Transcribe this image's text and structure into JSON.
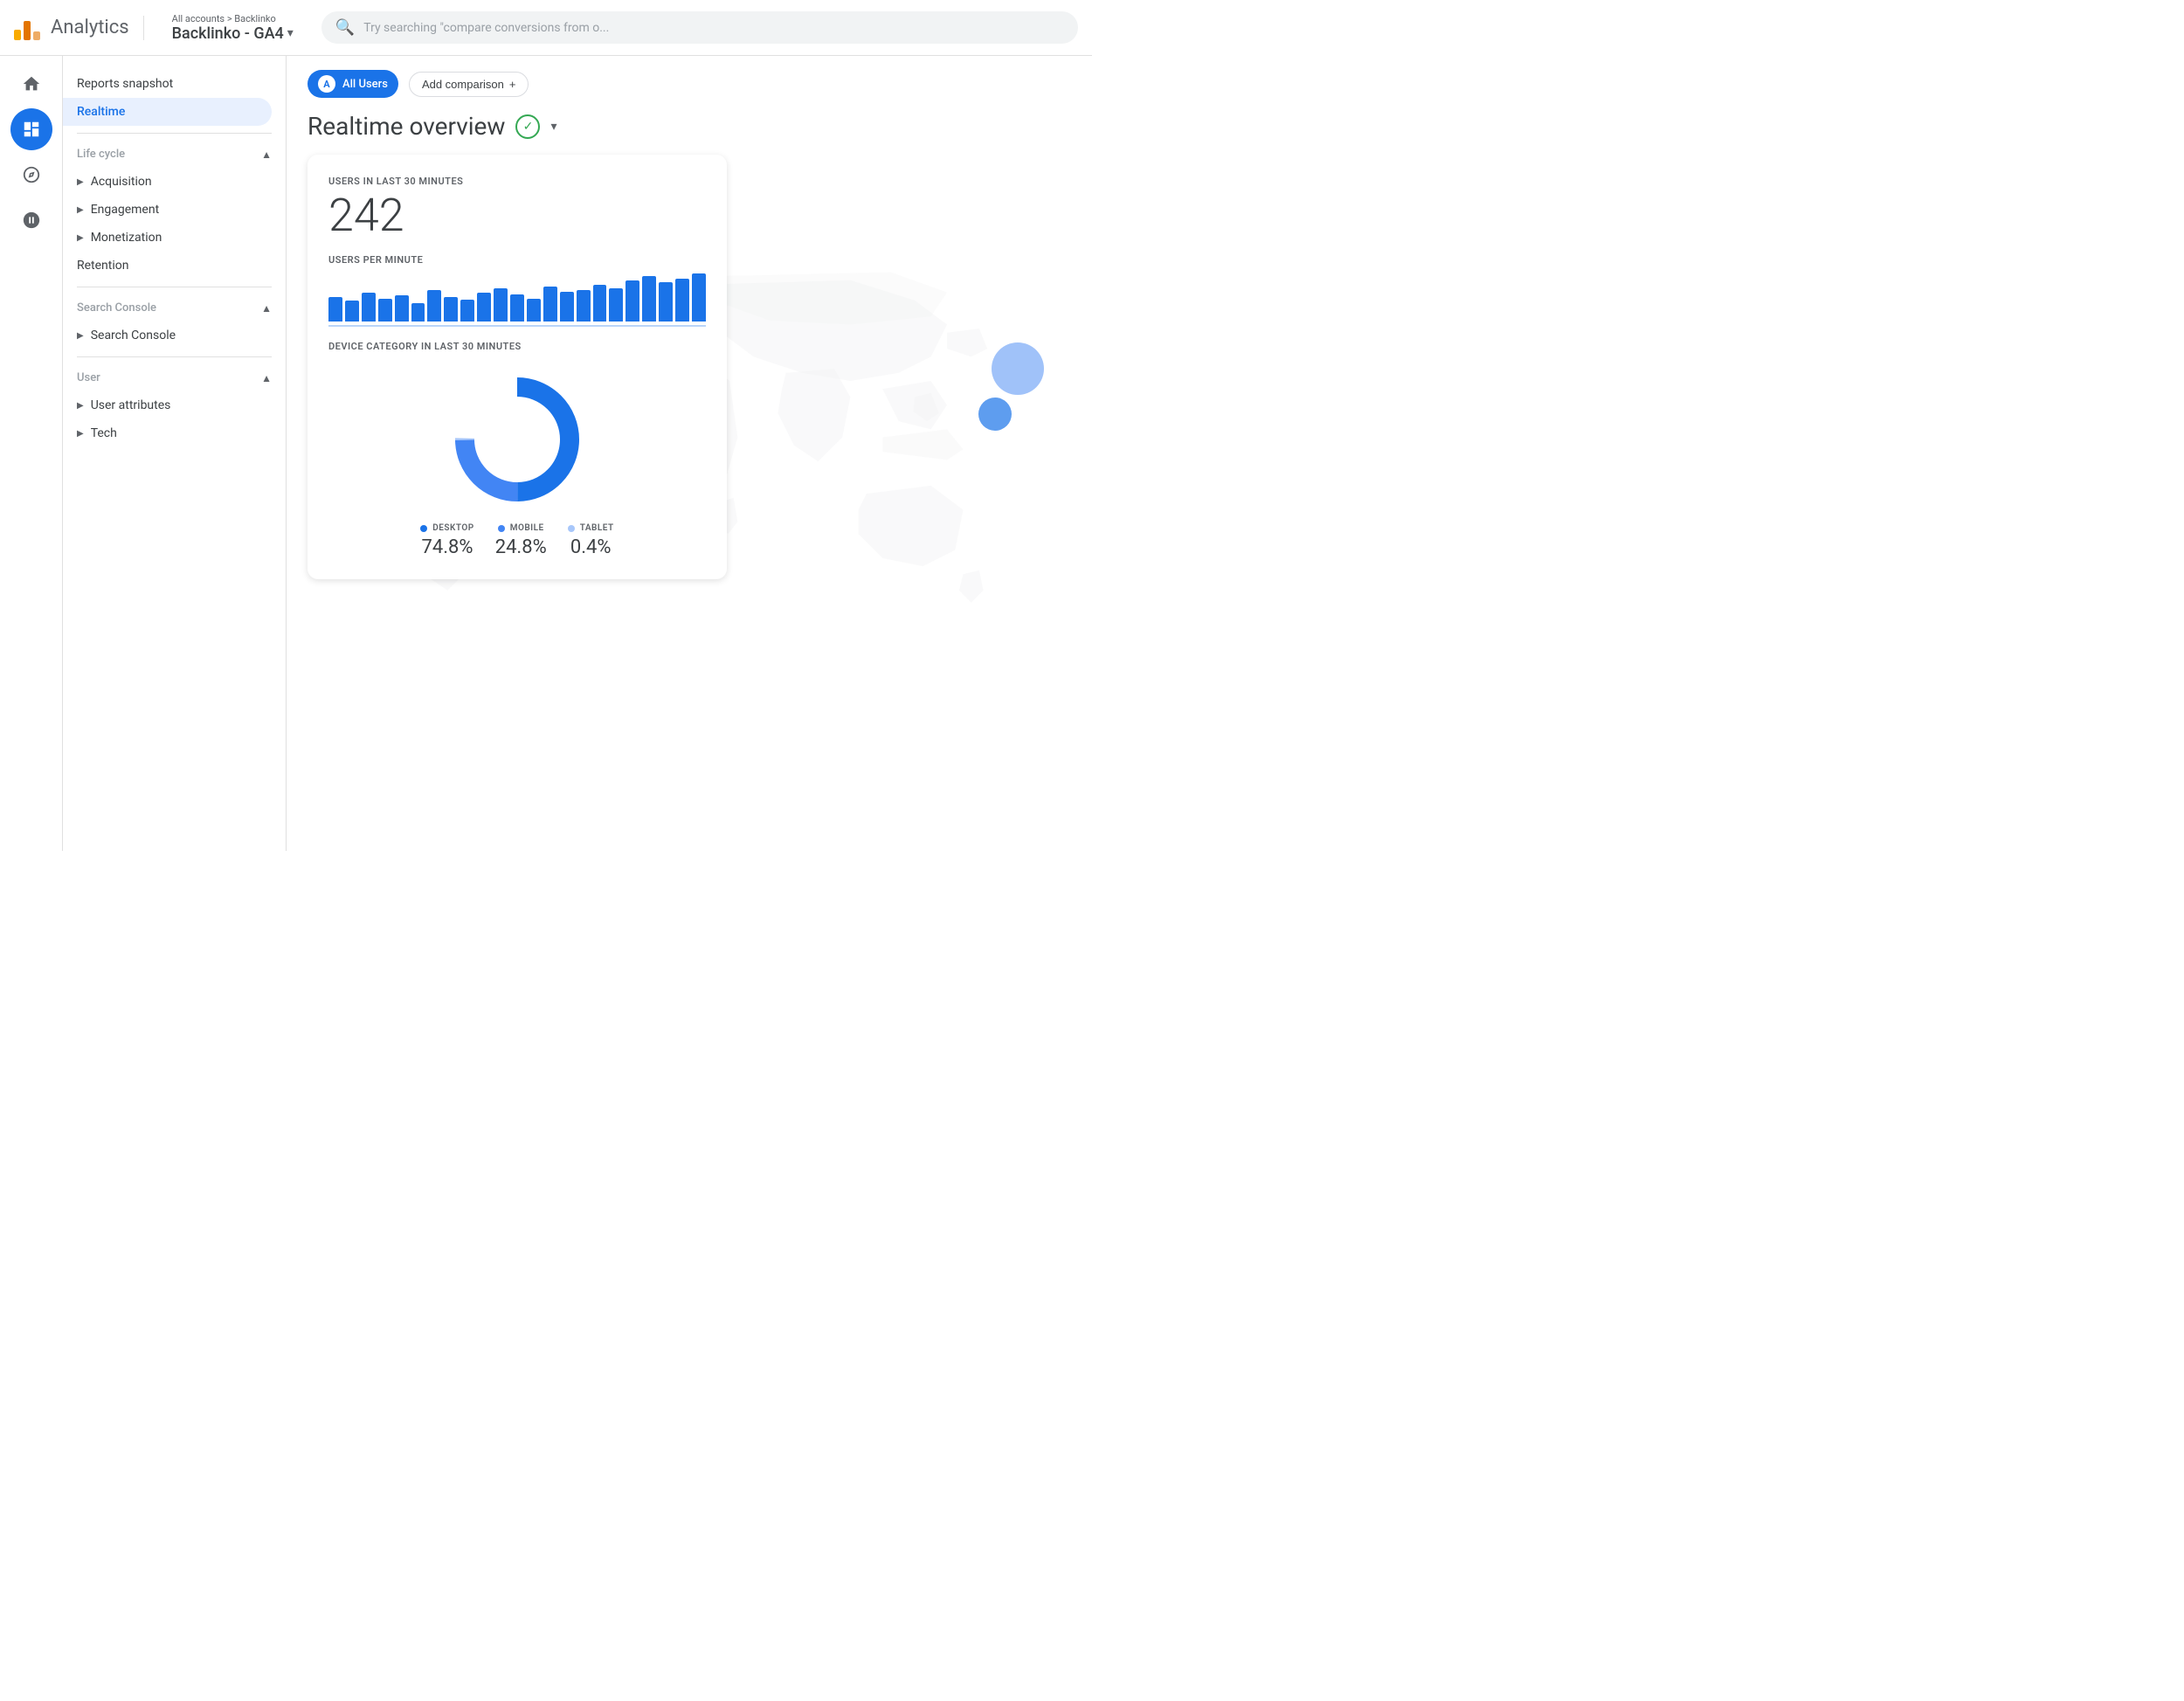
{
  "header": {
    "logo_text": "Analytics",
    "breadcrumb": "All accounts > Backlinko",
    "account_name": "Backlinko - GA4",
    "search_placeholder": "Try searching \"compare conversions from o...",
    "search_icon": "search-icon"
  },
  "nav_rail": {
    "items": [
      {
        "id": "home",
        "icon": "⌂",
        "label": "home-icon",
        "active": false
      },
      {
        "id": "reports",
        "icon": "▦",
        "label": "reports-icon",
        "active": true
      },
      {
        "id": "explore",
        "icon": "⌖",
        "label": "explore-icon",
        "active": false
      },
      {
        "id": "advertising",
        "icon": "◎",
        "label": "advertising-icon",
        "active": false
      }
    ]
  },
  "sidebar": {
    "snapshot_label": "Reports snapshot",
    "realtime_label": "Realtime",
    "lifecycle_section": "Life cycle",
    "lifecycle_items": [
      {
        "label": "Acquisition"
      },
      {
        "label": "Engagement"
      },
      {
        "label": "Monetization"
      },
      {
        "label": "Retention"
      }
    ],
    "search_console_section": "Search Console",
    "search_console_item": "Search Console",
    "user_section": "User",
    "user_items": [
      {
        "label": "User attributes"
      },
      {
        "label": "Tech"
      }
    ]
  },
  "filter_bar": {
    "all_users_label": "All Users",
    "user_avatar_letter": "A",
    "add_comparison_label": "Add comparison",
    "add_icon": "+"
  },
  "page": {
    "title": "Realtime overview",
    "verified_icon": "✓",
    "dropdown_icon": "▾"
  },
  "stats": {
    "users_30min_label": "USERS IN LAST 30 MINUTES",
    "users_30min_value": "242",
    "users_per_minute_label": "USERS PER MINUTE",
    "device_category_label": "DEVICE CATEGORY IN LAST 30 MINUTES",
    "bar_heights": [
      30,
      25,
      35,
      28,
      32,
      22,
      38,
      30,
      27,
      35,
      40,
      33,
      28,
      42,
      36,
      38,
      45,
      40,
      50,
      55,
      48,
      52,
      58
    ],
    "donut": {
      "desktop_pct": 74.8,
      "mobile_pct": 24.8,
      "tablet_pct": 0.4,
      "desktop_color": "#1a73e8",
      "mobile_color": "#4285f4",
      "tablet_color": "#a8c7fa",
      "desktop_label": "DESKTOP",
      "mobile_label": "MOBILE",
      "tablet_label": "TABLET",
      "desktop_value": "74.8%",
      "mobile_value": "24.8%",
      "tablet_value": "0.4%"
    }
  }
}
